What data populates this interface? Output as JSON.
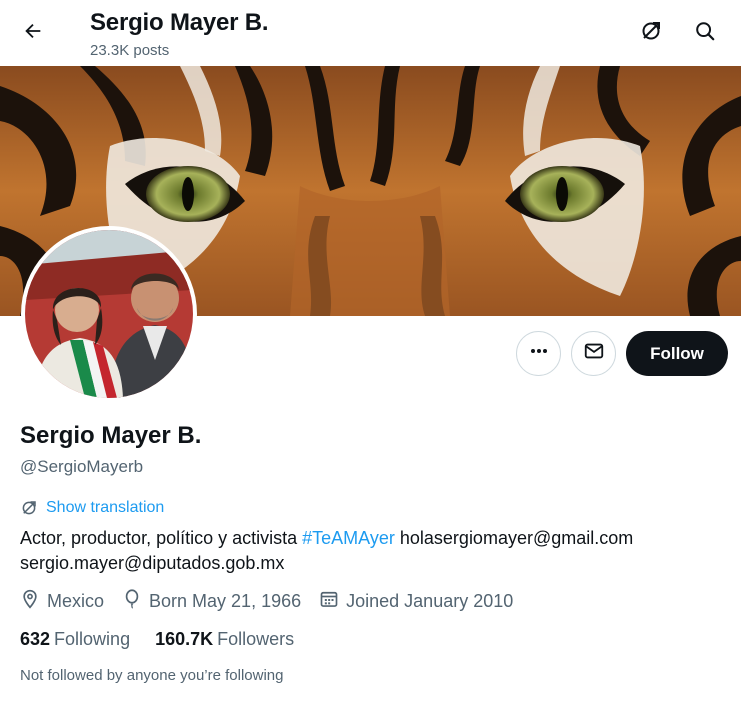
{
  "header": {
    "title": "Sergio Mayer B.",
    "posts_count": "23.3K posts"
  },
  "actions": {
    "follow_label": "Follow"
  },
  "profile": {
    "name": "Sergio Mayer B.",
    "handle": "@SergioMayerb",
    "show_translation": "Show translation",
    "bio_text": "Actor, productor, político y activista",
    "bio_hashtag": "#TeAMAyer",
    "bio_email_1": "holasergiomayer@gmail.com",
    "bio_email_2": "sergio.mayer@diputados.gob.mx",
    "location": "Mexico",
    "born": "Born May 21, 1966",
    "joined": "Joined January 2010",
    "following_count": "632",
    "following_label": "Following",
    "followers_count": "160.7K",
    "followers_label": "Followers",
    "not_followed_text": "Not followed by anyone you’re following"
  },
  "colors": {
    "accent": "#1d9bf0",
    "text_primary": "#0f1419",
    "text_secondary": "#536471",
    "button_dark": "#0f1419"
  },
  "icons": {
    "back": "arrow-left-icon",
    "translate": "translate-icon",
    "search": "search-icon",
    "more": "more-dots-icon",
    "message": "envelope-icon",
    "location": "location-pin-icon",
    "birthday": "balloon-icon",
    "calendar": "calendar-icon"
  }
}
